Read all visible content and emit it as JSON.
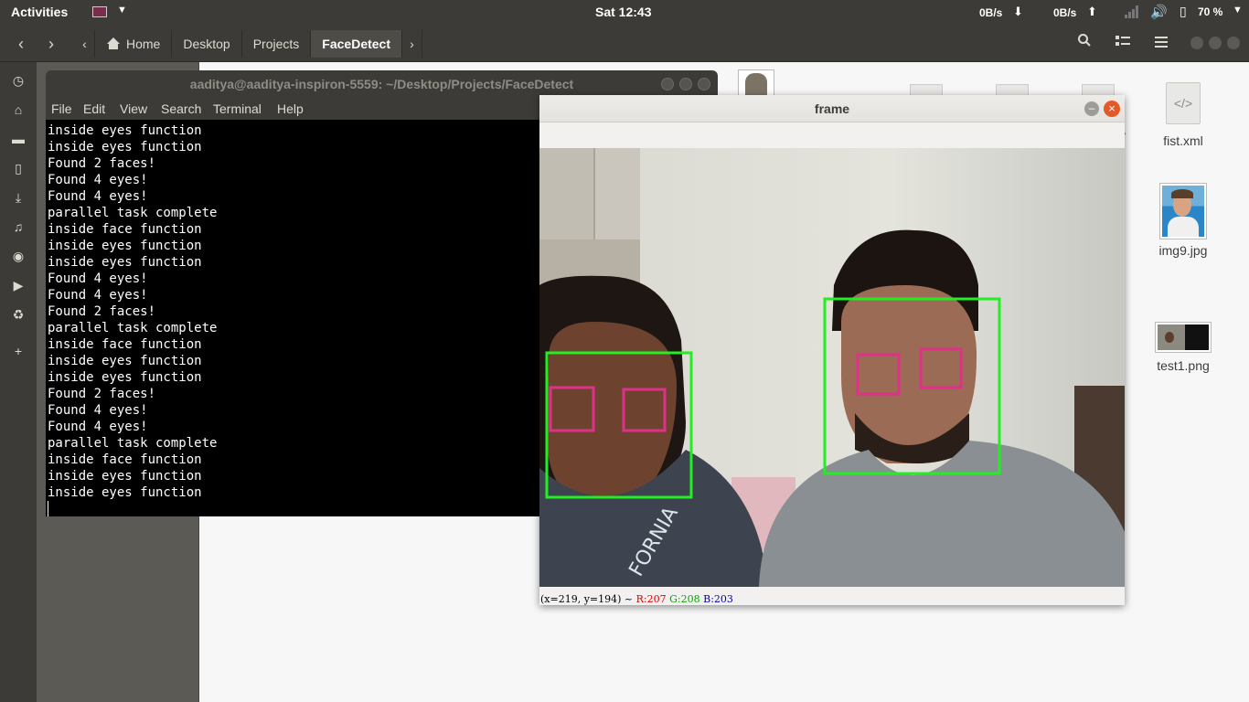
{
  "top_panel": {
    "activities": "Activities",
    "clock": "Sat 12:43",
    "net_down": "0B/s",
    "net_up": "0B/s",
    "battery_percent": "70 %"
  },
  "file_manager": {
    "breadcrumbs": [
      "Home",
      "Desktop",
      "Projects",
      "FaceDetect"
    ],
    "active_crumb": "FaceDetect",
    "files": [
      {
        "name": "fist.xml",
        "kind": "xml-file"
      },
      {
        "name": "img9.jpg",
        "kind": "image"
      },
      {
        "name": "test1.png",
        "kind": "image"
      }
    ],
    "partial_label": "y"
  },
  "terminal": {
    "title": "aaditya@aaditya-inspiron-5559: ~/Desktop/Projects/FaceDetect",
    "menu": [
      "File",
      "Edit",
      "View",
      "Search",
      "Terminal",
      "Help"
    ],
    "lines": [
      "inside eyes function",
      "inside eyes function",
      "Found 2 faces!",
      "Found 4 eyes!",
      "Found 4 eyes!",
      "parallel task complete",
      "inside face function",
      "inside eyes function",
      "inside eyes function",
      "Found 4 eyes!",
      "Found 4 eyes!",
      "Found 2 faces!",
      "parallel task complete",
      "inside face function",
      "inside eyes function",
      "inside eyes function",
      "Found 2 faces!",
      "Found 4 eyes!",
      "Found 4 eyes!",
      "parallel task complete",
      "inside face function",
      "inside eyes function",
      "inside eyes function"
    ]
  },
  "frame_window": {
    "title": "frame",
    "status": {
      "coords": "(x=219, y=194) ~",
      "r": "R:207",
      "g": "G:208",
      "b": "B:203"
    },
    "face_box_color": "#22ee22",
    "eye_box_color": "#e0308a"
  }
}
